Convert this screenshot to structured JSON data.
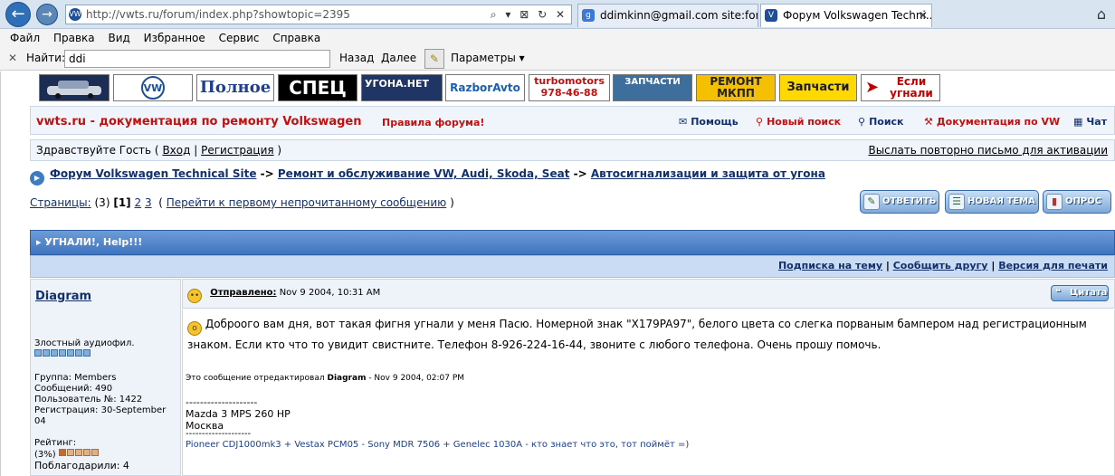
{
  "browser": {
    "back_icon": "arrow-left-icon",
    "forward_icon": "arrow-right-icon",
    "address": "http://vwts.ru/forum/index.php?showtopic=2395",
    "address_controls": "⌕ ▾ ⊠ ↻ ✕",
    "tabs": [
      {
        "label": "ddimkinn@gmail.com site:for...",
        "icon": "google-icon",
        "color": "#3b79d6"
      },
      {
        "label": "Форум Volkswagen Techni...",
        "icon": "vw-logo-icon",
        "color": "#1f4f99"
      }
    ],
    "tab_close": "✕",
    "home_icon": "home-icon"
  },
  "menubar": [
    "Файл",
    "Правка",
    "Вид",
    "Избранное",
    "Сервис",
    "Справка"
  ],
  "findbar": {
    "close": "✕",
    "label": "Найти:",
    "value": "ddi",
    "prev": "Назад",
    "next": "Далее",
    "options": "Параметры ▾"
  },
  "banners": [
    {
      "text": "",
      "bg": "#1b2c55",
      "fg": "#ffffff"
    },
    {
      "text": "VW",
      "bg": "#ffffff",
      "fg": "#1f4f99"
    },
    {
      "text": "Полное",
      "bg": "#ffffff",
      "fg": "#1f3f8f"
    },
    {
      "text": "СПЕЦ",
      "bg": "#000000",
      "fg": "#ffffff"
    },
    {
      "text": "УГОНА.НЕТ",
      "bg": "#1f3566",
      "fg": "#ffffff"
    },
    {
      "text": "RazborAvto",
      "bg": "#ffffff",
      "fg": "#1b5fb0"
    },
    {
      "text": "turbomotors 978-46-88",
      "bg": "#ffffff",
      "fg": "#c01010"
    },
    {
      "text": "ЗАПЧАСТИ",
      "bg": "#3d6e9c",
      "fg": "#ffffff"
    },
    {
      "text": "РЕМОНТ МКПП",
      "bg": "#f5c000",
      "fg": "#222222"
    },
    {
      "text": "Запчасти",
      "bg": "#ffd800",
      "fg": "#1a1a1a"
    },
    {
      "text": "Если угнали",
      "bg": "#ffffff",
      "fg": "#c00000"
    }
  ],
  "header": {
    "site_title": "vwts.ru - документация по ремонту Volkswagen",
    "rules": "Правила форума!",
    "links": [
      {
        "label": "Помощь",
        "icon": "help-icon"
      },
      {
        "label": "Новый поиск",
        "icon": "search-icon"
      },
      {
        "label": "Поиск",
        "icon": "search-icon"
      },
      {
        "label": "Документация по VW",
        "icon": "car-icon"
      },
      {
        "label": "Чат",
        "icon": "chat-icon"
      }
    ]
  },
  "welcome": {
    "greeting": "Здравствуйте Гость (",
    "login": "Вход",
    "sep": "|",
    "register": "Регистрация",
    "close": ")",
    "resend": "Выслать повторно письмо для активации"
  },
  "breadcrumb": {
    "items": [
      "Форум Volkswagen Technical Site",
      "Ремонт и обслуживание VW, Audi, Skoda, Seat",
      "Автосигнализации и защита от угона"
    ],
    "sep": "->"
  },
  "pagination": {
    "label": "Страницы:",
    "count": "(3)",
    "current": "[1]",
    "p2": "2",
    "p3": "3",
    "open": "(",
    "unread": "Перейти к первому непрочитанному сообщению",
    "close": ")"
  },
  "actions": {
    "reply": "ОТВЕТИТЬ",
    "new_topic": "НОВАЯ ТЕМА",
    "poll": "ОПРОС"
  },
  "topic": {
    "title": "▸ УГНАЛИ!, Help!!!",
    "subscribe": "Подписка на тему",
    "tell_friend": "Сообщить другу",
    "print": "Версия для печати",
    "sep": "|"
  },
  "post": {
    "author": "Diagram",
    "posted_label": "Отправлено:",
    "posted_date": "Nov 9 2004, 10:31 AM",
    "quote": "Цитата",
    "text": "Доброого вам дня, вот такая фигня угнали у меня Пасю. Номерной знак \"X179PA97\", белого цвета со слегка порваным бампером над регистрационным знаком. Если кто что то увидит свистните. Телефон 8-926-224-16-44, звоните с любого телефона. Очень прошу помочь.",
    "edited_prefix": "Это сообщение отредактировал",
    "edited_by": "Diagram",
    "edited_suffix": "- Nov 9 2004, 02:07 PM",
    "sig_line": "--------------------",
    "sig_car": "Mazda 3 MPS 260 HP",
    "sig_city": "Москва",
    "sig_line2": "--------------------",
    "sig_gear": "Pioneer CDJ1000mk3 + Vestax PCM05 - Sony MDR 7506 + Genelec 1030A - кто знает что это, тот поймёт =)"
  },
  "profile": {
    "rank": "Злостный аудиофил.",
    "group": "Группа: Members",
    "posts": "Сообщений: 490",
    "user_no": "Пользователь №: 1422",
    "reg": "Регистрация: 30-September 04",
    "rating_label": "Рейтинг:",
    "rating_value": "(3%)",
    "thanks": "Поблагодарили: 4"
  }
}
